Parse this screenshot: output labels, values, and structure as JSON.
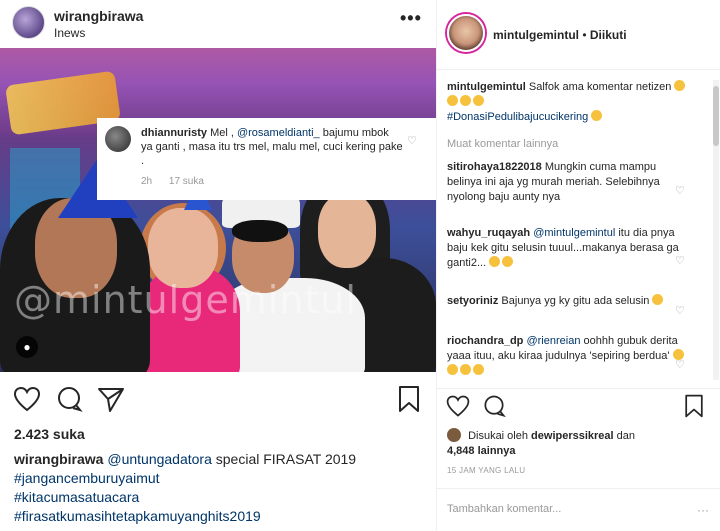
{
  "left_post": {
    "username": "wirangbirawa",
    "location": "Inews",
    "watermark": "@mintulgemintul",
    "overlay_comment": {
      "username": "dhiannuristy",
      "text_pre": " Mel , ",
      "mention": "@rosameldianti_",
      "text_post": " bajumu mbok ya ganti , masa itu trs mel, malu mel, cuci kering pake .",
      "time": "2h",
      "likes": "17 suka"
    },
    "likes": "2.423 suka",
    "caption_user": "wirangbirawa",
    "caption_mention": "@untungadatora",
    "caption_text": " special FIRASAT 2019",
    "hashtags": [
      "#jangancemburuyaimut",
      "#kitacumasatuacara",
      "#firasatkumasihtetapkamuyanghits2019"
    ]
  },
  "right_post": {
    "username": "mintulgemintul",
    "follow_status": "Diikuti",
    "caption": {
      "user": "mintulgemintul",
      "text": " Salfok ama komentar netizen",
      "hashtag": "#DonasiPedulibajucucikering"
    },
    "more_comments_label": "Muat komentar lainnya",
    "comments": [
      {
        "user": "sitirohaya1822018",
        "text": " Mungkin cuma mampu belinya ini aja yg murah meriah. Selebihnya nyolong baju aunty nya"
      },
      {
        "user": "wahyu_ruqayah",
        "mention": "@mintulgemintul",
        "text": " itu dia pnya baju kek gitu selusin tuuul...makanya berasa ga ganti2..."
      },
      {
        "user": "setyoriniz",
        "text": " Bajunya yg ky gitu ada selusin"
      },
      {
        "user": "riochandra_dp",
        "mention": "@rienreian",
        "text": " oohhh gubuk derita yaaa ituu, aku kiraa judulnya 'sepiring berdua'"
      }
    ],
    "liked_by_prefix": "Disukai oleh",
    "liked_by_user": "dewiperssikreal",
    "liked_by_suffix": "dan",
    "liked_by_count": "4,848 lainnya",
    "time_ago": "15 JAM YANG LALU",
    "add_comment_placeholder": "Tambahkan komentar..."
  }
}
